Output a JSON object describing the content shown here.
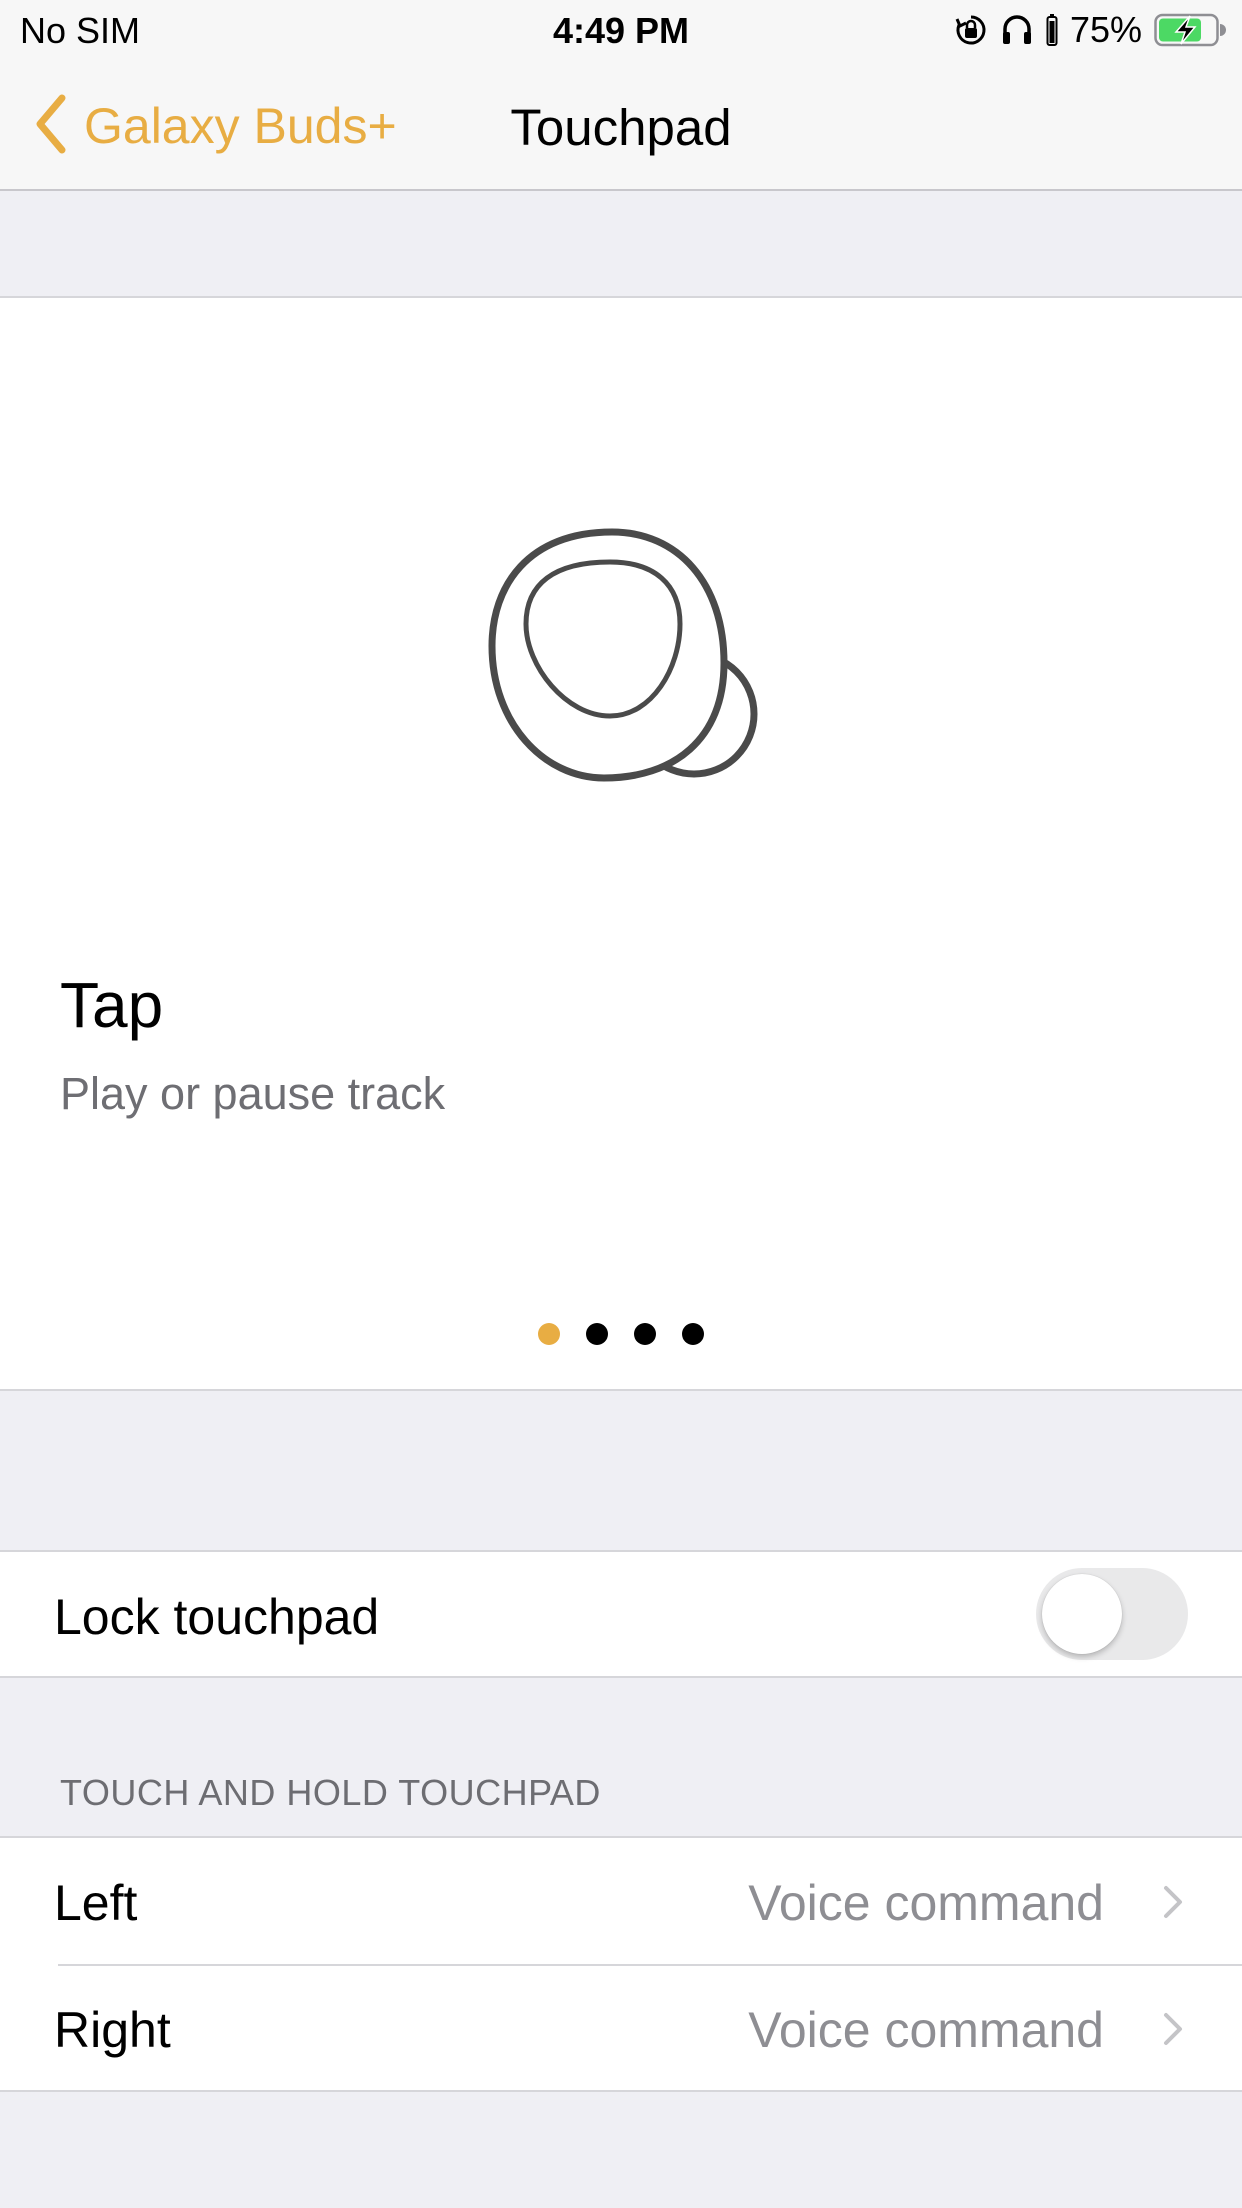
{
  "status_bar": {
    "carrier": "No SIM",
    "time": "4:49 PM",
    "battery_percent": "75%",
    "battery_level": 0.75,
    "icons": [
      "orientation-lock-icon",
      "headphones-icon",
      "battery-charging-icon"
    ]
  },
  "nav": {
    "back_label": "Galaxy Buds+",
    "title": "Touchpad",
    "accent_color": "#e8ad43"
  },
  "carousel": {
    "illustration": "earbud-icon",
    "gesture_title": "Tap",
    "gesture_description": "Play or pause track",
    "page_count": 4,
    "current_page": 1
  },
  "lock_touchpad": {
    "label": "Lock touchpad",
    "enabled": false
  },
  "touch_and_hold": {
    "header": "TOUCH AND HOLD TOUCHPAD",
    "rows": [
      {
        "label": "Left",
        "value": "Voice command"
      },
      {
        "label": "Right",
        "value": "Voice command"
      }
    ]
  }
}
